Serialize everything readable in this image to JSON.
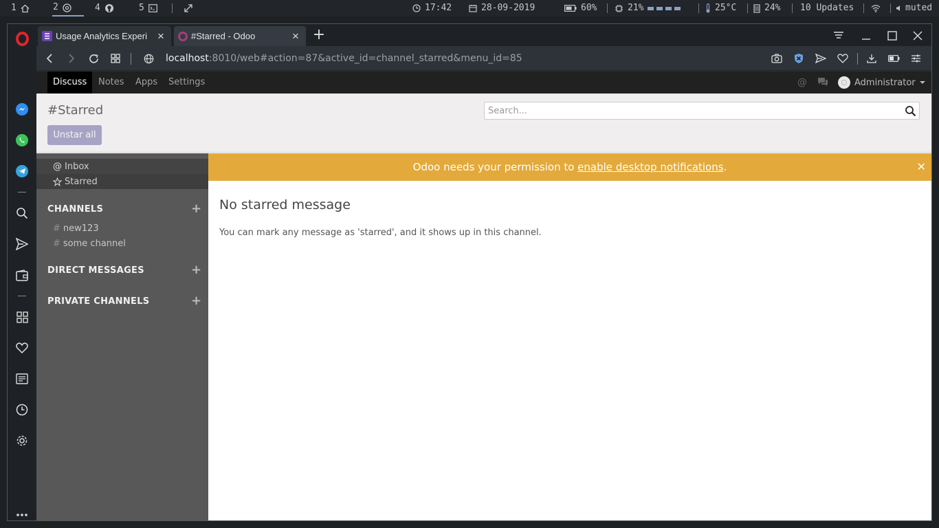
{
  "sysbar": {
    "workspaces": [
      {
        "num": "1",
        "icon": "home-icon"
      },
      {
        "num": "2",
        "icon": "chrome-icon"
      },
      {
        "num": "4",
        "icon": "github-icon"
      },
      {
        "num": "5",
        "icon": "terminal-icon"
      }
    ],
    "time": "17:42",
    "date": "28-09-2019",
    "battery": "60%",
    "cpu": "21%",
    "temp": "25°C",
    "mem": "24%",
    "updates": "10 Updates",
    "volume": "muted"
  },
  "browser": {
    "tabs": [
      {
        "title": "Usage Analytics Experi",
        "favicon_color": "#6a3fb5"
      },
      {
        "title": "#Starred - Odoo",
        "favicon_color": "#a23f78"
      }
    ],
    "url_host": "localhost",
    "url_rest": ":8010/web#action=87&active_id=channel_starred&menu_id=85"
  },
  "odoo": {
    "menus": [
      "Discuss",
      "Notes",
      "Apps",
      "Settings"
    ],
    "user": "Administrator",
    "breadcrumb": "#Starred",
    "unstar_label": "Unstar all",
    "search_placeholder": "Search...",
    "sidebar": {
      "inbox": "Inbox",
      "starred": "Starred",
      "channels_header": "CHANNELS",
      "channels": [
        "new123",
        "some channel"
      ],
      "direct_header": "DIRECT MESSAGES",
      "private_header": "PRIVATE CHANNELS"
    },
    "notification": {
      "prefix": "Odoo needs your permission to ",
      "link": "enable desktop notifications",
      "suffix": "."
    },
    "empty_title": "No starred message",
    "empty_text": "You can mark any message as 'starred', and it shows up in this channel."
  },
  "colors": {
    "accent_button": "#a7a3c4",
    "notification_bg": "#e3a93b",
    "sidebar_bg": "#585858"
  }
}
